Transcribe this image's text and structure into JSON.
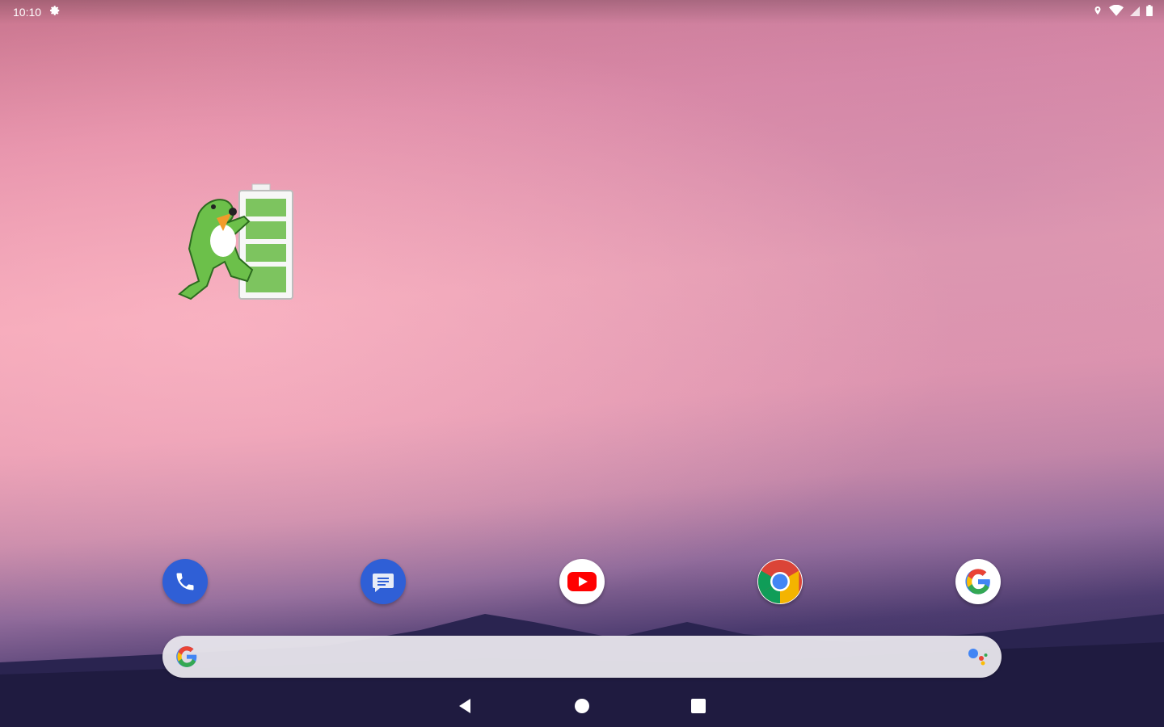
{
  "status_bar": {
    "time": "10:10",
    "icons": [
      "settings-gear-icon",
      "location-icon",
      "wifi-icon",
      "signal-icon",
      "battery-icon"
    ]
  },
  "home_widget": {
    "icon": "gecko-battery-widget-icon"
  },
  "dock": {
    "apps": [
      {
        "icon": "phone-icon",
        "color": "#2f5fd6"
      },
      {
        "icon": "messages-icon",
        "color": "#2f5fd6"
      },
      {
        "icon": "youtube-icon",
        "color": "#ff0000"
      },
      {
        "icon": "chrome-icon",
        "color": "#1a73e8"
      },
      {
        "icon": "google-icon",
        "color": "#4285f4"
      }
    ]
  },
  "search_bar": {
    "placeholder": "",
    "left_icon": "google-g-icon",
    "right_icon": "google-assistant-icon"
  },
  "nav_bar": {
    "buttons": [
      "back-icon",
      "home-icon",
      "recents-icon"
    ]
  }
}
